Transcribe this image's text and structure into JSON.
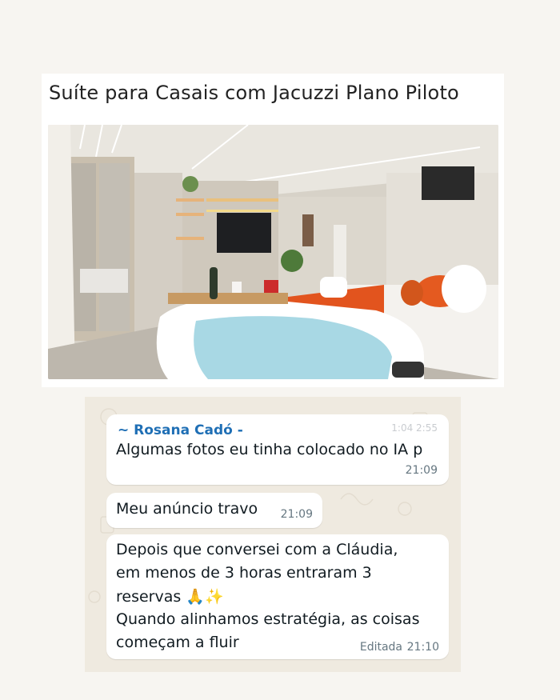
{
  "listing": {
    "title": "Suíte para Casais com Jacuzzi Plano Piloto"
  },
  "chat": {
    "messages": [
      {
        "sender": "~ Rosana Cadó -",
        "text": "Algumas fotos eu tinha colocado no IA p",
        "time": "21:09",
        "faded_time": "1:04 2:55"
      },
      {
        "text": "Meu anúncio travo",
        "time": "21:09"
      },
      {
        "lines": [
          "Depois que conversei com a Cláudia,",
          "em menos de 3 horas entraram 3",
          "reservas 🙏✨",
          "Quando alinhamos estratégia, as coisas",
          "começam a fluir"
        ],
        "edited_label": "Editada",
        "time": "21:10"
      }
    ]
  },
  "colors": {
    "page_bg": "#f7f5f1",
    "chat_bg": "#efeae0",
    "sender": "#1f6fb5",
    "timestamp": "#667781"
  }
}
